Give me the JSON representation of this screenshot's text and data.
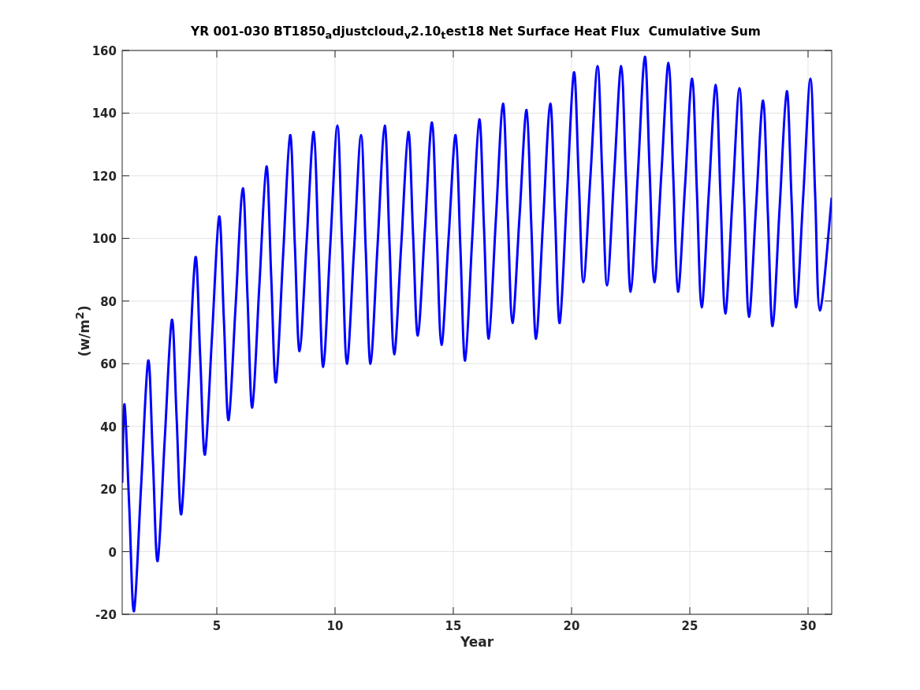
{
  "figure": {
    "chart_data": {
      "type": "line",
      "title": "YR 001-030 BT1850$_{a}$djustcloud$_{v}$2.10$_{t}$est18 Net Surface Heat Flux  Cumulative Sum",
      "xlabel": "Year",
      "ylabel": "(w/m$^{2}$)",
      "xlim": [
        1,
        31
      ],
      "ylim": [
        -20,
        160
      ],
      "xticks": [
        5,
        10,
        15,
        20,
        25,
        30
      ],
      "yticks": [
        -20,
        0,
        20,
        40,
        60,
        80,
        100,
        120,
        140,
        160
      ],
      "grid": true,
      "x": [
        1,
        1.1,
        1.3,
        1.5,
        1.8,
        2.1,
        2.3,
        2.5,
        2.8,
        3.1,
        3.3,
        3.5,
        3.8,
        4.1,
        4.3,
        4.5,
        4.8,
        5.1,
        5.3,
        5.5,
        5.8,
        6.1,
        6.3,
        6.5,
        6.8,
        7.1,
        7.3,
        7.5,
        7.8,
        8.1,
        8.3,
        8.5,
        8.8,
        9.1,
        9.3,
        9.5,
        9.8,
        10.1,
        10.3,
        10.5,
        10.8,
        11.1,
        11.3,
        11.5,
        11.8,
        12.1,
        12.3,
        12.5,
        12.8,
        13.1,
        13.3,
        13.5,
        13.8,
        14.1,
        14.3,
        14.5,
        14.8,
        15.1,
        15.3,
        15.5,
        15.8,
        16.1,
        16.3,
        16.5,
        16.8,
        17.1,
        17.3,
        17.5,
        17.8,
        18.1,
        18.3,
        18.5,
        18.8,
        19.1,
        19.3,
        19.5,
        19.8,
        20.1,
        20.3,
        20.5,
        20.8,
        21.1,
        21.3,
        21.5,
        21.8,
        22.1,
        22.3,
        22.5,
        22.8,
        23.1,
        23.3,
        23.5,
        23.8,
        24.1,
        24.3,
        24.5,
        24.8,
        25.1,
        25.3,
        25.5,
        25.8,
        26.1,
        26.3,
        26.5,
        26.8,
        27.1,
        27.3,
        27.5,
        27.8,
        28.1,
        28.3,
        28.5,
        28.8,
        29.1,
        29.3,
        29.5,
        29.8,
        30.1,
        30.3,
        30.5,
        31
      ],
      "series": [
        {
          "color": "#0000ff",
          "values": [
            22,
            47,
            14,
            -19,
            21,
            61,
            29,
            -3,
            36,
            74,
            43,
            12,
            53,
            94,
            62,
            31,
            69,
            107,
            74,
            42,
            79,
            116,
            81,
            46,
            85,
            123,
            88,
            54,
            94,
            133,
            98,
            64,
            99,
            134,
            96,
            59,
            98,
            136,
            98,
            60,
            96,
            133,
            96,
            60,
            98,
            136,
            99,
            63,
            98,
            134,
            101,
            69,
            103,
            137,
            101,
            66,
            100,
            133,
            97,
            61,
            100,
            138,
            103,
            68,
            106,
            143,
            108,
            73,
            107,
            141,
            104,
            68,
            106,
            143,
            108,
            73,
            113,
            153,
            120,
            86,
            120,
            155,
            120,
            85,
            120,
            155,
            119,
            83,
            120,
            158,
            122,
            86,
            121,
            156,
            120,
            83,
            117,
            151,
            115,
            78,
            114,
            149,
            113,
            76,
            112,
            148,
            112,
            75,
            110,
            144,
            108,
            72,
            110,
            147,
            113,
            78,
            114,
            151,
            114,
            77,
            113
          ]
        }
      ]
    }
  }
}
